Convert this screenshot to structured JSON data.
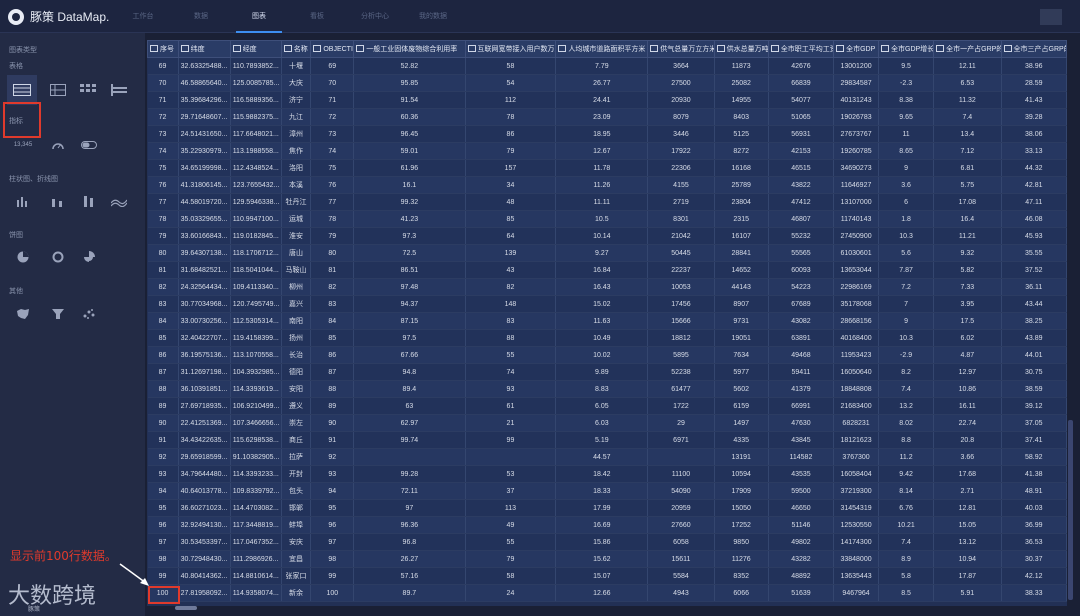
{
  "app": {
    "name": "豚策 DataMap."
  },
  "nav": {
    "tabs": [
      "工作台",
      "数据",
      "图表",
      "看板",
      "分析中心",
      "我的数据"
    ],
    "active": 2
  },
  "sidebar": {
    "title": "图表类型",
    "sections": [
      "表格",
      "指标",
      "柱状图、折线图",
      "饼图",
      "其他"
    ],
    "kpi_sample": "13,345"
  },
  "table": {
    "columns": [
      "序号",
      "纬度",
      "经度",
      "名称",
      "OBJECTID",
      "一般工业固体废物综合利用率",
      "互联网宽带接入用户数万人",
      "人均城市道路面积平方米",
      "供气总量万立方米",
      "供水总量万吨",
      "全市职工平均工资",
      "全市GDP",
      "全市GDP增长率",
      "全市一产占GRP的比例",
      "全市三产占GRP的比"
    ],
    "rows": [
      [
        "69",
        "32.63325488...",
        "110.7893852...",
        "十堰",
        "69",
        "52.82",
        "58",
        "7.79",
        "3664",
        "11873",
        "42676",
        "13001200",
        "9.5",
        "12.11",
        "38.96"
      ],
      [
        "70",
        "46.58865640...",
        "125.0085785...",
        "大庆",
        "70",
        "95.85",
        "54",
        "26.77",
        "27500",
        "25082",
        "66839",
        "29834587",
        "-2.3",
        "6.53",
        "28.59"
      ],
      [
        "71",
        "35.39684296...",
        "116.5889356...",
        "济宁",
        "71",
        "91.54",
        "112",
        "24.41",
        "20930",
        "14955",
        "54077",
        "40131243",
        "8.38",
        "11.32",
        "41.43"
      ],
      [
        "72",
        "29.71648607...",
        "115.9882375...",
        "九江",
        "72",
        "60.36",
        "78",
        "23.09",
        "8079",
        "8403",
        "51065",
        "19026783",
        "9.65",
        "7.4",
        "39.28"
      ],
      [
        "73",
        "24.51431650...",
        "117.6648021...",
        "漳州",
        "73",
        "96.45",
        "86",
        "18.95",
        "3446",
        "5125",
        "56931",
        "27673767",
        "11",
        "13.4",
        "38.06"
      ],
      [
        "74",
        "35.22930979...",
        "113.1988558...",
        "焦作",
        "74",
        "59.01",
        "79",
        "12.67",
        "17922",
        "8272",
        "42153",
        "19260785",
        "8.65",
        "7.12",
        "33.13"
      ],
      [
        "75",
        "34.65199998...",
        "112.4348524...",
        "洛阳",
        "75",
        "61.96",
        "157",
        "11.78",
        "22306",
        "16168",
        "46515",
        "34690273",
        "9",
        "6.81",
        "44.32"
      ],
      [
        "76",
        "41.31806145...",
        "123.7655432...",
        "本溪",
        "76",
        "16.1",
        "34",
        "11.26",
        "4155",
        "25789",
        "43822",
        "11646927",
        "3.6",
        "5.75",
        "42.81"
      ],
      [
        "77",
        "44.58019720...",
        "129.5946338...",
        "牡丹江",
        "77",
        "99.32",
        "48",
        "11.11",
        "2719",
        "23804",
        "47412",
        "13107000",
        "6",
        "17.08",
        "47.11"
      ],
      [
        "78",
        "35.03329655...",
        "110.9947100...",
        "运城",
        "78",
        "41.23",
        "85",
        "10.5",
        "8301",
        "2315",
        "46807",
        "11740143",
        "1.8",
        "16.4",
        "46.08"
      ],
      [
        "79",
        "33.60166843...",
        "119.0182845...",
        "淮安",
        "79",
        "97.3",
        "64",
        "10.14",
        "21042",
        "16107",
        "55232",
        "27450900",
        "10.3",
        "11.21",
        "45.93"
      ],
      [
        "80",
        "39.64307138...",
        "118.1706712...",
        "唐山",
        "80",
        "72.5",
        "139",
        "9.27",
        "50445",
        "28841",
        "55565",
        "61030601",
        "5.6",
        "9.32",
        "35.55"
      ],
      [
        "81",
        "31.68482521...",
        "118.5041044...",
        "马鞍山",
        "81",
        "86.51",
        "43",
        "16.84",
        "22237",
        "14652",
        "60093",
        "13653044",
        "7.87",
        "5.82",
        "37.52"
      ],
      [
        "82",
        "24.32564434...",
        "109.4113340...",
        "柳州",
        "82",
        "97.48",
        "82",
        "16.43",
        "10053",
        "44143",
        "54223",
        "22986169",
        "7.2",
        "7.33",
        "36.11"
      ],
      [
        "83",
        "30.77034968...",
        "120.7495749...",
        "嘉兴",
        "83",
        "94.37",
        "148",
        "15.02",
        "17456",
        "8907",
        "67689",
        "35178068",
        "7",
        "3.95",
        "43.44"
      ],
      [
        "84",
        "33.00730256...",
        "112.5305314...",
        "南阳",
        "84",
        "87.15",
        "83",
        "11.63",
        "15666",
        "9731",
        "43082",
        "28668156",
        "9",
        "17.5",
        "38.25"
      ],
      [
        "85",
        "32.40422707...",
        "119.4158399...",
        "扬州",
        "85",
        "97.5",
        "88",
        "10.49",
        "18812",
        "19051",
        "63891",
        "40168400",
        "10.3",
        "6.02",
        "43.89"
      ],
      [
        "86",
        "36.19575136...",
        "113.1070558...",
        "长治",
        "86",
        "67.66",
        "55",
        "10.02",
        "5895",
        "7634",
        "49468",
        "11953423",
        "-2.9",
        "4.87",
        "44.01"
      ],
      [
        "87",
        "31.12697198...",
        "104.3932985...",
        "德阳",
        "87",
        "94.8",
        "74",
        "9.89",
        "52238",
        "5977",
        "59411",
        "16050640",
        "8.2",
        "12.97",
        "30.75"
      ],
      [
        "88",
        "36.10391851...",
        "114.3393619...",
        "安阳",
        "88",
        "89.4",
        "93",
        "8.83",
        "61477",
        "5602",
        "41379",
        "18848808",
        "7.4",
        "10.86",
        "38.59"
      ],
      [
        "89",
        "27.69718935...",
        "106.9210499...",
        "遵义",
        "89",
        "63",
        "61",
        "6.05",
        "1722",
        "6159",
        "66991",
        "21683400",
        "13.2",
        "16.11",
        "39.12"
      ],
      [
        "90",
        "22.41251369...",
        "107.3466656...",
        "崇左",
        "90",
        "62.97",
        "21",
        "6.03",
        "29",
        "1497",
        "47630",
        "6828231",
        "8.02",
        "22.74",
        "37.05"
      ],
      [
        "91",
        "34.43422635...",
        "115.6298538...",
        "商丘",
        "91",
        "99.74",
        "99",
        "5.19",
        "6971",
        "4335",
        "43845",
        "18121623",
        "8.8",
        "20.8",
        "37.41"
      ],
      [
        "92",
        "29.65918599...",
        "91.10382905...",
        "拉萨",
        "92",
        "",
        "",
        "44.57",
        "",
        "13191",
        "114582",
        "3767300",
        "11.2",
        "3.66",
        "58.92"
      ],
      [
        "93",
        "34.79644480...",
        "114.3393233...",
        "开封",
        "93",
        "99.28",
        "53",
        "18.42",
        "11100",
        "10594",
        "43535",
        "16058404",
        "9.42",
        "17.68",
        "41.38"
      ],
      [
        "94",
        "40.64013778...",
        "109.8339792...",
        "包头",
        "94",
        "72.11",
        "37",
        "18.33",
        "54090",
        "17909",
        "59500",
        "37219300",
        "8.14",
        "2.71",
        "48.91"
      ],
      [
        "95",
        "36.60271023...",
        "114.4703082...",
        "邯郸",
        "95",
        "97",
        "113",
        "17.99",
        "20959",
        "15050",
        "46650",
        "31454319",
        "6.76",
        "12.81",
        "40.03"
      ],
      [
        "96",
        "32.92494130...",
        "117.3448819...",
        "蚌埠",
        "96",
        "96.36",
        "49",
        "16.69",
        "27660",
        "17252",
        "51146",
        "12530550",
        "10.21",
        "15.05",
        "36.99"
      ],
      [
        "97",
        "30.53453397...",
        "117.0467352...",
        "安庆",
        "97",
        "96.8",
        "55",
        "15.86",
        "6058",
        "9850",
        "49802",
        "14174300",
        "7.4",
        "13.12",
        "36.53"
      ],
      [
        "98",
        "30.72948430...",
        "111.2986926...",
        "宜昌",
        "98",
        "26.27",
        "79",
        "15.62",
        "15611",
        "11276",
        "43282",
        "33848000",
        "8.9",
        "10.94",
        "30.37"
      ],
      [
        "99",
        "40.80414362...",
        "114.8810614...",
        "张家口",
        "99",
        "57.16",
        "58",
        "15.07",
        "5584",
        "8352",
        "48892",
        "13635443",
        "5.8",
        "17.87",
        "42.12"
      ],
      [
        "100",
        "27.81958092...",
        "114.9358074...",
        "新余",
        "100",
        "89.7",
        "24",
        "12.66",
        "4943",
        "6066",
        "51639",
        "9467964",
        "8.5",
        "5.91",
        "38.33"
      ]
    ]
  },
  "annotation": {
    "text": "显示前100行数据。"
  },
  "watermark": {
    "text": "大数跨境",
    "sub": "豚策"
  },
  "colors": {
    "accent": "#3d8ef0",
    "highlight": "#e03a2c",
    "background": "#1a2035"
  }
}
